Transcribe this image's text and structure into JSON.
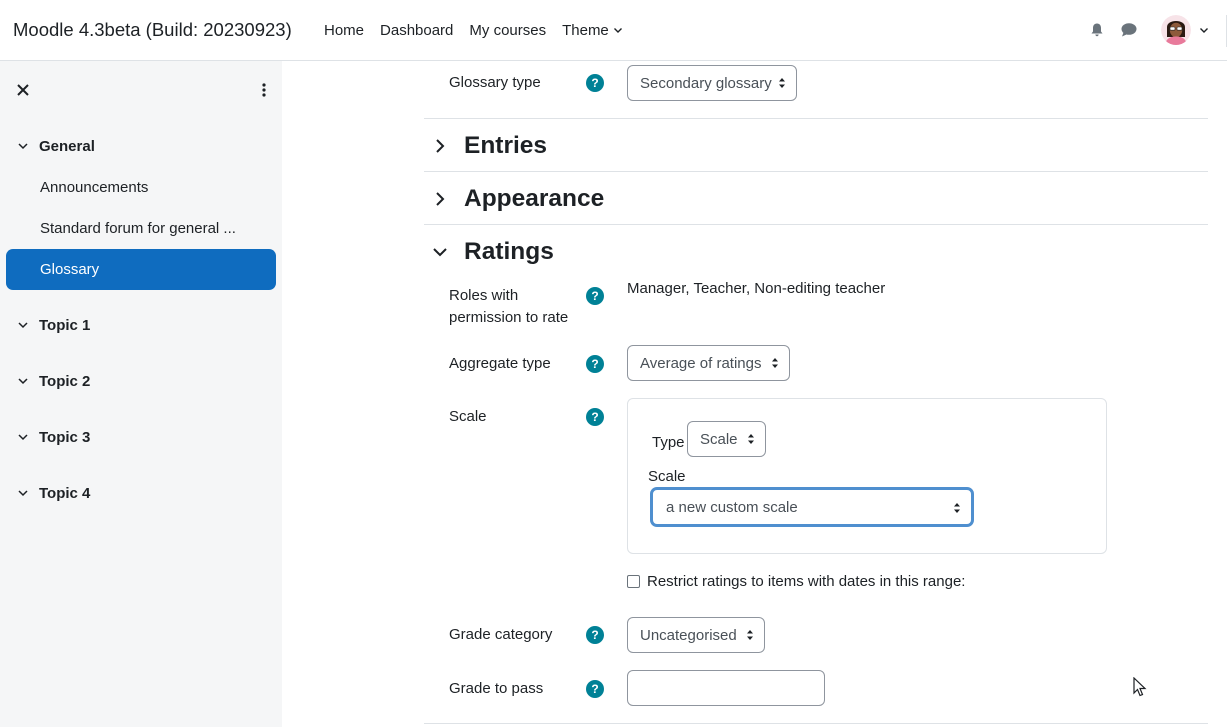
{
  "navbar": {
    "brand": "Moodle 4.3beta (Build: 20230923)",
    "links": [
      {
        "label": "Home"
      },
      {
        "label": "Dashboard"
      },
      {
        "label": "My courses"
      },
      {
        "label": "Theme"
      }
    ],
    "icons": [
      "bell-icon",
      "chat-icon",
      "avatar",
      "chevron-down-icon"
    ]
  },
  "drawer": {
    "sections": [
      {
        "label": "General",
        "expanded": true
      },
      {
        "label": "Topic 1",
        "expanded": true
      },
      {
        "label": "Topic 2",
        "expanded": true
      },
      {
        "label": "Topic 3",
        "expanded": true
      },
      {
        "label": "Topic 4",
        "expanded": true
      }
    ],
    "activities": [
      {
        "label": "Announcements",
        "active": false
      },
      {
        "label": "Standard forum for general ...",
        "active": false
      },
      {
        "label": "Glossary",
        "active": true
      }
    ]
  },
  "form": {
    "glossary_type": {
      "label": "Glossary type",
      "value": "Secondary glossary"
    },
    "sections": {
      "entries": {
        "label": "Entries",
        "expanded": false
      },
      "appearance": {
        "label": "Appearance",
        "expanded": false
      },
      "ratings": {
        "label": "Ratings",
        "expanded": true
      }
    },
    "roles": {
      "label_line1": "Roles with",
      "label_line2": "permission to rate",
      "value": "Manager, Teacher, Non-editing teacher"
    },
    "aggregate": {
      "label": "Aggregate type",
      "value": "Average of ratings"
    },
    "scale": {
      "label": "Scale",
      "type_label": "Type",
      "type_value": "Scale",
      "scale_label": "Scale",
      "scale_value": "a new custom scale"
    },
    "restrict": {
      "label": "Restrict ratings to items with dates in this range:",
      "checked": false
    },
    "grade_category": {
      "label": "Grade category",
      "value": "Uncategorised"
    },
    "grade_to_pass": {
      "label": "Grade to pass",
      "value": ""
    }
  },
  "colors": {
    "accent": "#0f6cbf",
    "help": "#008196",
    "drawer_bg": "#f5f6f7"
  }
}
